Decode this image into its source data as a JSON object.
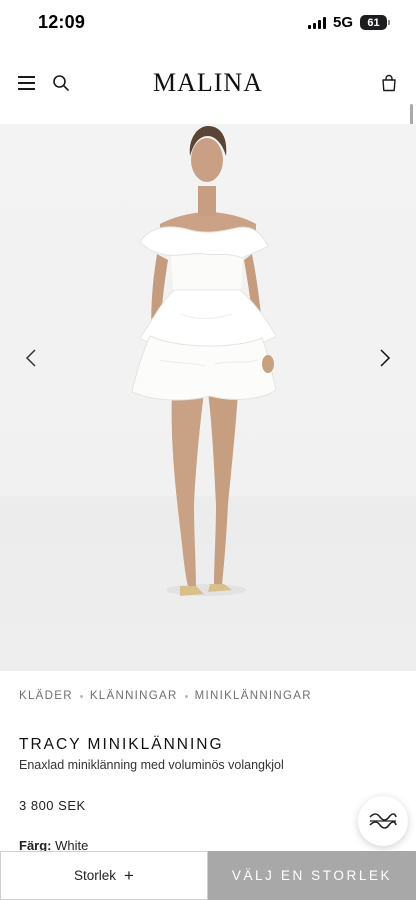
{
  "status_bar": {
    "time": "12:09",
    "network": "5G",
    "battery": "61"
  },
  "header": {
    "logo": "MALINA",
    "menu_icon": "menu-icon",
    "search_icon": "search-icon",
    "bag_icon": "shopping-bag-icon"
  },
  "gallery": {
    "prev_icon": "chevron-left-icon",
    "next_icon": "chevron-right-icon"
  },
  "breadcrumb": [
    "KLÄDER",
    "KLÄNNINGAR",
    "MINIKLÄNNINGAR"
  ],
  "product": {
    "title": "TRACY MINIKLÄNNING",
    "subtitle": "Enaxlad miniklänning med voluminös volangkjol",
    "price": "3 800 SEK",
    "color_label": "Färg:",
    "color_value": "White"
  },
  "bottom_bar": {
    "size_label": "Storlek",
    "size_plus": "+",
    "cta_label": "VÄLJ EN STORLEK"
  },
  "colors": {
    "cta_background": "#a8a8a8",
    "image_background": "#f1f1f1"
  }
}
